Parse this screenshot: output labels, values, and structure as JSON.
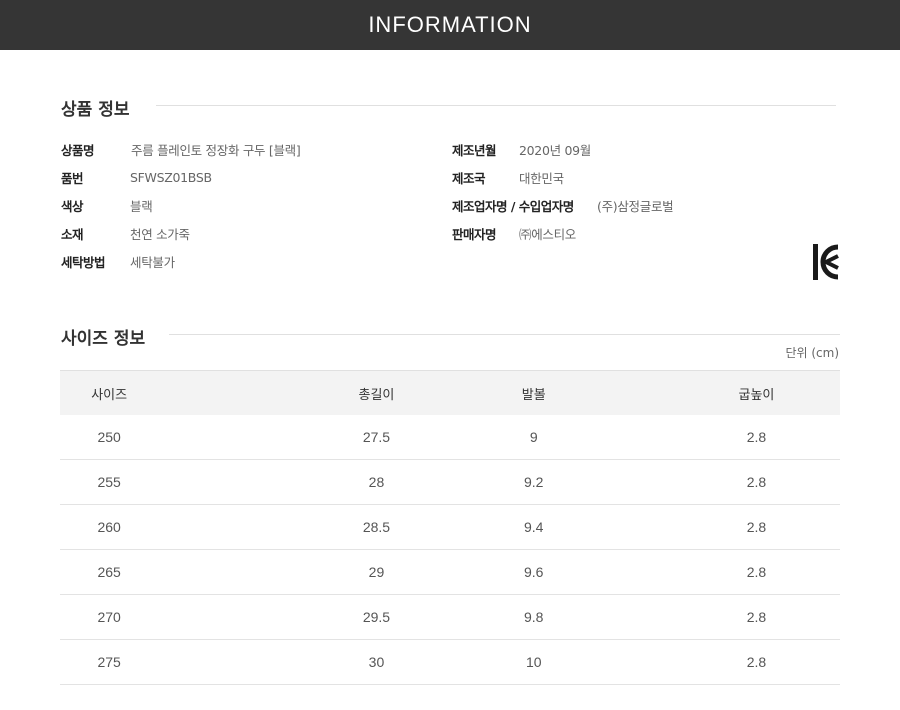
{
  "header": {
    "title": "INFORMATION"
  },
  "product_section": {
    "title": "상품 정보",
    "left": [
      {
        "key": "상품명",
        "value": "주름 플레인토 정장화 구두 [블랙]"
      },
      {
        "key": "품번",
        "value": "SFWSZ01BSB"
      },
      {
        "key": "색상",
        "value": "블랙"
      },
      {
        "key": "소재",
        "value": "천연 소가죽"
      },
      {
        "key": "세탁방법",
        "value": "세탁불가"
      }
    ],
    "right": [
      {
        "key": "제조년월",
        "value": "2020년 09월"
      },
      {
        "key": "제조국",
        "value": "대한민국"
      },
      {
        "key": "제조업자명 / 수입업자명",
        "value": "(주)삼정글로벌"
      },
      {
        "key": "판매자명",
        "value": "㈜에스티오"
      }
    ],
    "kc_mark_color": "#1a1a1a"
  },
  "size_section": {
    "title": "사이즈 정보",
    "unit": "단위 (cm)",
    "columns": [
      "사이즈",
      "총길이",
      "발볼",
      "굽높이"
    ],
    "rows": [
      [
        "250",
        "27.5",
        "9",
        "2.8"
      ],
      [
        "255",
        "28",
        "9.2",
        "2.8"
      ],
      [
        "260",
        "28.5",
        "9.4",
        "2.8"
      ],
      [
        "265",
        "29",
        "9.6",
        "2.8"
      ],
      [
        "270",
        "29.5",
        "9.8",
        "2.8"
      ],
      [
        "275",
        "30",
        "10",
        "2.8"
      ]
    ]
  },
  "colors": {
    "header_bg": "#353535",
    "table_head_bg": "#f3f3f3",
    "rule": "#e0e0e0"
  }
}
